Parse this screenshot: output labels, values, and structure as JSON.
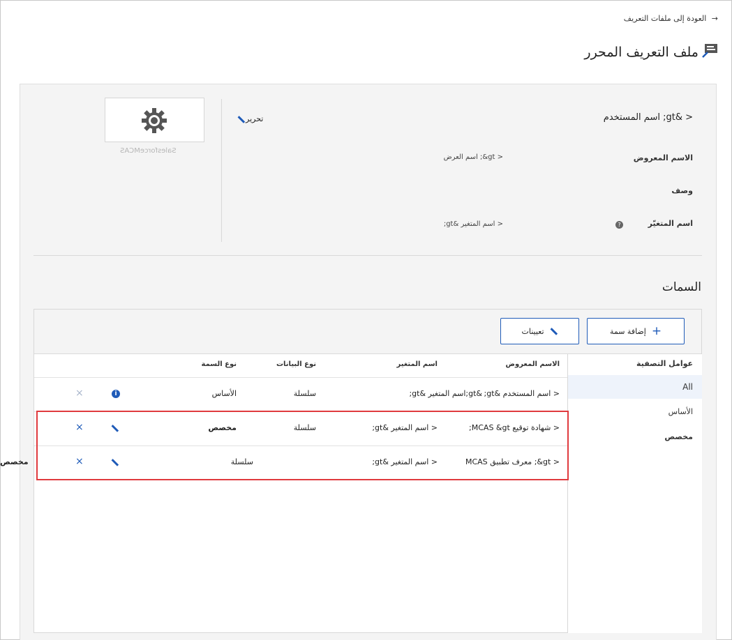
{
  "nav": {
    "back_label": "العودة إلى ملفات التعريف",
    "back_arrow": "→"
  },
  "header": {
    "title": "ملف التعريف  المحرر",
    "icon": "profile-card-icon"
  },
  "app_card": {
    "icon": "gear-icon",
    "name": "SalesforceMCAS"
  },
  "details": {
    "title": "< &gt; اسم المستخدم",
    "edit_label": "تحرير",
    "fields": [
      {
        "label": "الاسم المعروض",
        "value": "< gt&; اسم العرض"
      },
      {
        "label": "وصف",
        "value": ""
      },
      {
        "label": "اسم المتغيّر",
        "value": "< اسم المتغير &gt;",
        "help": "?"
      }
    ]
  },
  "attributes": {
    "title": "السمات",
    "add_label": "إضافة سمة",
    "add_glyph": "+",
    "assign_label": "تعيينات",
    "filters_title": "عوامل التصفية",
    "filters": [
      "All",
      "الأساس",
      "مخصص"
    ],
    "columns": [
      "الاسم المعروض",
      "اسم المتغير",
      "نوع البيانات",
      "نوع السمة"
    ],
    "rows": [
      {
        "display": "< اسم المستخدم &gt;",
        "variable": "&gt;اسم المتغير &gt;",
        "data_type": "سلسلة",
        "attr_type": "الأساس",
        "action": "info-icon",
        "delete": "×"
      },
      {
        "display": "< شهادة توقيع MCAS &gt;",
        "variable": "< اسم المتغير &gt;",
        "data_type": "سلسلة",
        "attr_type": "مخصص",
        "action": "pencil-icon",
        "delete": "×"
      },
      {
        "display": "< gt&; معرف تطبيق MCAS",
        "variable": "< اسم المتغير &gt;",
        "data_type": "",
        "attr_type": "سلسلة",
        "action": "pencil-icon",
        "delete": "×"
      }
    ],
    "overflow_label": "مخصص"
  }
}
